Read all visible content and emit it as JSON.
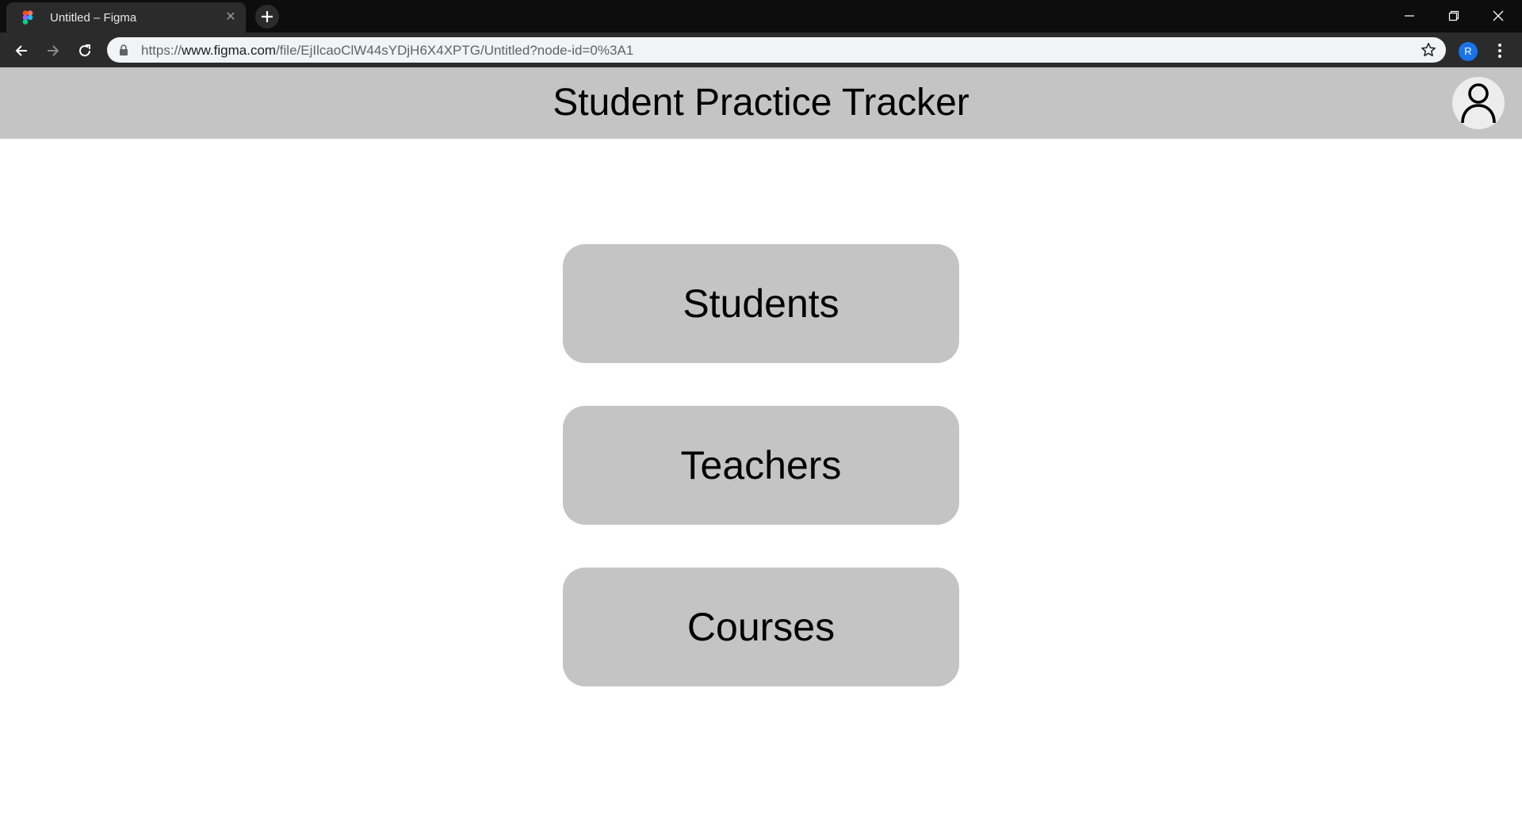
{
  "browser": {
    "tab": {
      "title": "Untitled – Figma",
      "close_glyph": "✕"
    },
    "address_bar": {
      "url_prefix": "https://",
      "url_host": "www.figma.com",
      "url_path": "/file/EjIlcaoClW44sYDjH6X4XPTG/Untitled?node-id=0%3A1"
    },
    "profile_initial": "R",
    "icons": {
      "favicon": "figma-logo-icon",
      "new_tab": "plus-icon",
      "back": "arrow-left-icon",
      "forward": "arrow-right-icon",
      "reload": "reload-icon",
      "lock": "lock-icon",
      "bookmark": "star-icon",
      "menu": "kebab-menu-icon",
      "minimize": "minimize-icon",
      "restore": "restore-icon",
      "close": "close-icon"
    }
  },
  "app": {
    "title": "Student Practice Tracker",
    "user_icon": "user-icon",
    "nav_buttons": [
      {
        "label": "Students"
      },
      {
        "label": "Teachers"
      },
      {
        "label": "Courses"
      }
    ],
    "colors": {
      "header_bg": "#c4c4c4",
      "button_bg": "#c4c4c4",
      "page_bg": "#ffffff"
    }
  }
}
